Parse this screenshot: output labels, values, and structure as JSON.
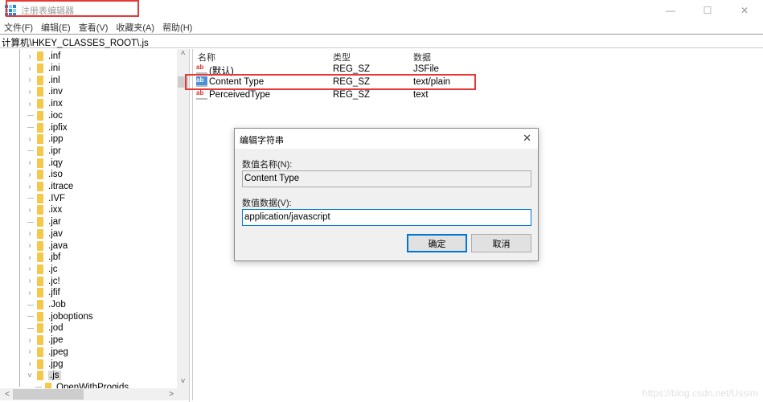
{
  "window": {
    "title": "注册表编辑器",
    "controls": {
      "minimize": "—",
      "maximize": "☐",
      "close": "✕"
    }
  },
  "menu": [
    "文件(F)",
    "编辑(E)",
    "查看(V)",
    "收藏夹(A)",
    "帮助(H)"
  ],
  "address": "计算机\\HKEY_CLASSES_ROOT\\.js",
  "tree": {
    "items": [
      {
        "label": ".inf",
        "expandable": true
      },
      {
        "label": ".ini",
        "expandable": true
      },
      {
        "label": ".inl",
        "expandable": true
      },
      {
        "label": ".inv",
        "expandable": true
      },
      {
        "label": ".inx",
        "expandable": true
      },
      {
        "label": ".ioc",
        "expandable": false
      },
      {
        "label": ".ipfix",
        "expandable": false
      },
      {
        "label": ".ipp",
        "expandable": true
      },
      {
        "label": ".ipr",
        "expandable": false
      },
      {
        "label": ".iqy",
        "expandable": true
      },
      {
        "label": ".iso",
        "expandable": true
      },
      {
        "label": ".itrace",
        "expandable": true
      },
      {
        "label": ".IVF",
        "expandable": false
      },
      {
        "label": ".ixx",
        "expandable": true
      },
      {
        "label": ".jar",
        "expandable": false
      },
      {
        "label": ".jav",
        "expandable": true
      },
      {
        "label": ".java",
        "expandable": true
      },
      {
        "label": ".jbf",
        "expandable": true
      },
      {
        "label": ".jc",
        "expandable": true
      },
      {
        "label": ".jc!",
        "expandable": true
      },
      {
        "label": ".jfif",
        "expandable": true
      },
      {
        "label": ".Job",
        "expandable": false
      },
      {
        "label": ".joboptions",
        "expandable": false
      },
      {
        "label": ".jod",
        "expandable": false
      },
      {
        "label": ".jpe",
        "expandable": true
      },
      {
        "label": ".jpeg",
        "expandable": true
      },
      {
        "label": ".jpg",
        "expandable": true
      },
      {
        "label": ".js",
        "expandable": true,
        "expanded": true,
        "selected": true
      },
      {
        "label": "OpenWithProgids",
        "expandable": false,
        "child": true
      }
    ]
  },
  "values": {
    "columns": [
      "名称",
      "类型",
      "数据"
    ],
    "rows": [
      {
        "name": "(默认)",
        "type": "REG_SZ",
        "data": "JSFile"
      },
      {
        "name": "Content Type",
        "type": "REG_SZ",
        "data": "text/plain",
        "selected": true
      },
      {
        "name": "PerceivedType",
        "type": "REG_SZ",
        "data": "text"
      }
    ]
  },
  "dialog": {
    "title": "编辑字符串",
    "name_label": "数值名称(N):",
    "name_value": "Content Type",
    "data_label": "数值数据(V):",
    "data_value": "application/javascript",
    "ok_label": "确定",
    "cancel_label": "取消"
  },
  "watermark": "https://blog.csdn.net/Ussim",
  "colors": {
    "highlight": "#e53935",
    "accent": "#0078d7",
    "folder": "#f5c84c"
  }
}
